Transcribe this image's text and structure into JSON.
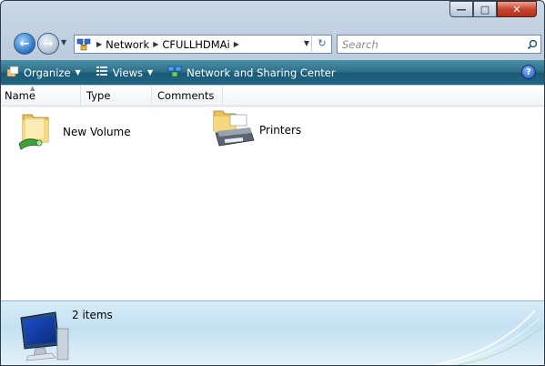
{
  "window": {
    "caption_buttons": [
      "minimize",
      "maximize",
      "close"
    ]
  },
  "address_bar": {
    "crumbs": [
      "Network",
      "CFULLHDMAi"
    ],
    "icon": "network-icon"
  },
  "search": {
    "placeholder": "Search"
  },
  "toolbar": {
    "organize_label": "Organize",
    "views_label": "Views",
    "network_label": "Network and Sharing Center",
    "help_label": "?"
  },
  "columns": {
    "name": "Name",
    "type": "Type",
    "comments": "Comments"
  },
  "items": [
    {
      "label": "New Volume",
      "icon": "shared-folder-icon"
    },
    {
      "label": "Printers",
      "icon": "printers-folder-icon"
    }
  ],
  "details": {
    "count_text": "2 items",
    "icon": "computer-icon"
  },
  "colors": {
    "toolbar_top": "#4a8fa6",
    "toolbar_bottom": "#1c5a76",
    "details_bg": "#c4e1f2",
    "close_button": "#c7452e"
  }
}
